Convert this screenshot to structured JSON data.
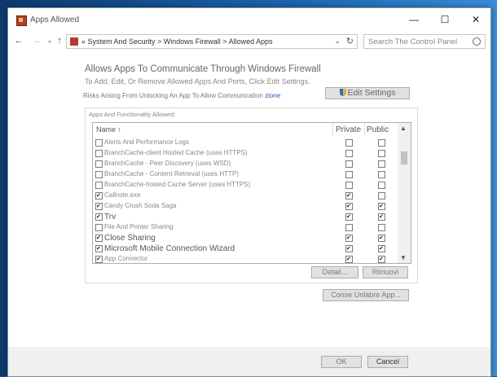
{
  "window": {
    "title": "Apps Allowed",
    "minimize": "—",
    "maximize": "☐",
    "close": "✕"
  },
  "nav": {
    "back": "←",
    "forward": "→",
    "dropdown": "⌄",
    "up": "↑",
    "address": "« System And Security > Windows Firewall > Allowed Apps",
    "address_dropdown": "⌄",
    "refresh": "↻",
    "search_placeholder": "Search The Control Panel"
  },
  "main": {
    "heading": "Allows Apps To Communicate Through Windows Firewall",
    "subheading": "To Add, Edit, Or Remove Allowed Apps And Ports, Click Edit Settings.",
    "risk_text": "Risks Arising From Unlocking An App To Allow Communication",
    "risk_link": "zione",
    "edit_settings": "Edit Settings"
  },
  "apps": {
    "group_label": "Apps And Functionality Allowed:",
    "col_name": "Name ↑",
    "col_private": "Private",
    "col_public": "Public",
    "rows": [
      {
        "name": "Alerts And Performance Logs",
        "checked": false,
        "private": false,
        "public": false,
        "big": false
      },
      {
        "name": "BranchCache-client Hosted Cache (uses HTTPS)",
        "checked": false,
        "private": false,
        "public": false,
        "big": false
      },
      {
        "name": "BranchCache - Peer Discovery (uses WSD)",
        "checked": false,
        "private": false,
        "public": false,
        "big": false
      },
      {
        "name": "BranchCache - Content Retrieval (uses HTTP)",
        "checked": false,
        "private": false,
        "public": false,
        "big": false
      },
      {
        "name": "BranchCache-hosted Cache Server (uses HTTPS)",
        "checked": false,
        "private": false,
        "public": false,
        "big": false
      },
      {
        "name": "Callnote.exe",
        "checked": true,
        "private": true,
        "public": false,
        "big": false
      },
      {
        "name": "Candy Crush Soda Saga",
        "checked": true,
        "private": true,
        "public": true,
        "big": false
      },
      {
        "name": "Trv",
        "checked": true,
        "private": true,
        "public": true,
        "big": true
      },
      {
        "name": "File And Printer Sharing",
        "checked": false,
        "private": false,
        "public": false,
        "big": false
      },
      {
        "name": "Close Sharing",
        "checked": true,
        "private": true,
        "public": true,
        "big": true
      },
      {
        "name": "Microsoft Mobile Connection Wizard",
        "checked": true,
        "private": true,
        "public": true,
        "big": true
      },
      {
        "name": "App Connector",
        "checked": true,
        "private": true,
        "public": true,
        "big": false
      }
    ],
    "details_button": "Detail...",
    "remove_button": "Rimuovi",
    "allow_other_button": "Conse Unlabre App..."
  },
  "footer": {
    "ok": "OK",
    "cancel": "Cancel"
  }
}
